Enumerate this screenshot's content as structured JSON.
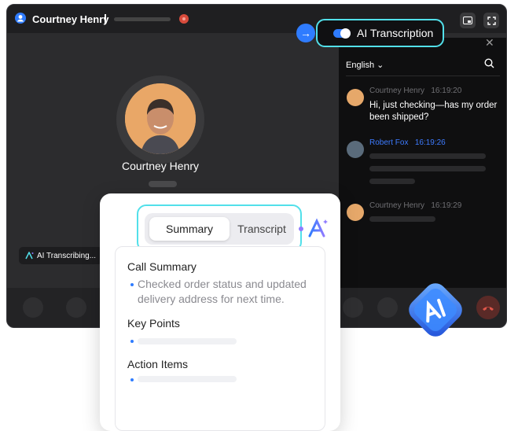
{
  "call": {
    "caller_name": "Courtney Henry",
    "main_name": "Courtney Henry",
    "ai_badge": "AI Transcribing..."
  },
  "ai_toggle": {
    "label": "AI Transcription",
    "enabled": true
  },
  "panel": {
    "language": "English",
    "messages": [
      {
        "sender": "Courtney Henry",
        "time": "16:19:20",
        "text": "Hi, just checking—has my order been shipped?"
      },
      {
        "sender": "Robert Fox",
        "time": "16:19:26"
      },
      {
        "sender": "Courtney Henry",
        "time": "16:19:29"
      }
    ]
  },
  "summary_card": {
    "tabs": [
      "Summary",
      "Transcript"
    ],
    "active_tab": "Summary",
    "call_summary_title": "Call Summary",
    "call_summary_text": "Checked order status and updated delivery address for next time.",
    "key_points_title": "Key Points",
    "action_items_title": "Action Items"
  },
  "colors": {
    "accent": "#2f7cff",
    "highlight": "#52e0ea",
    "hangup": "#d84b3c"
  }
}
